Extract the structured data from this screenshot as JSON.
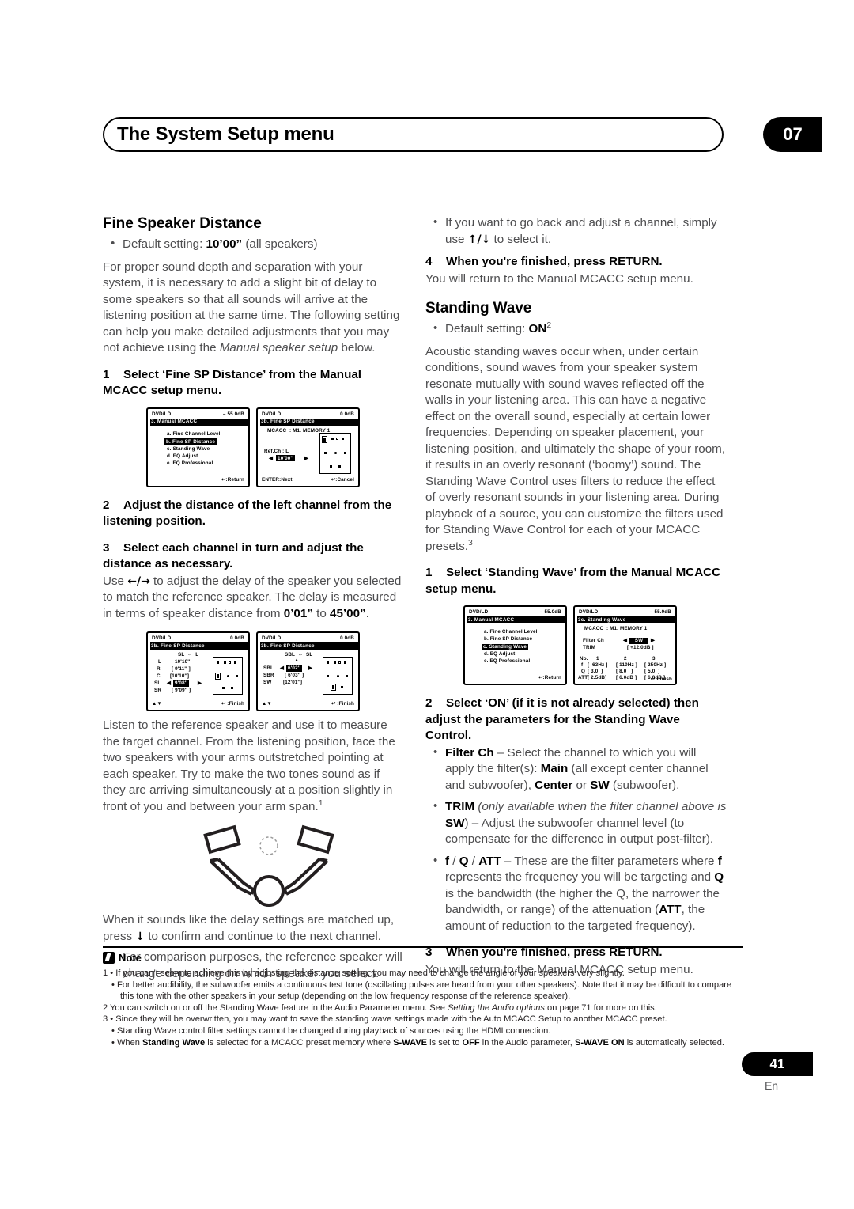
{
  "header": {
    "title": "The System Setup menu",
    "chapter": "07"
  },
  "left_column": {
    "section1_title": "Fine Speaker Distance",
    "default_bullet_pre": "Default setting: ",
    "default_bullet_value": "10’00”",
    "default_bullet_post": " (all speakers)",
    "intro": "For proper sound depth and separation with your system, it is necessary to add a slight bit of delay to some speakers so that all sounds will arrive at the listening position at the same time. The following setting can help you make detailed adjustments that you may not achieve using the ",
    "intro_italic": "Manual speaker setup",
    "intro_end": " below.",
    "step1_num": "1",
    "step1": "Select ‘Fine SP Distance’ from the Manual MCACC setup menu.",
    "step2_num": "2",
    "step2": "Adjust the distance of the left channel from the listening position.",
    "step3_num": "3",
    "step3": "Select each channel in turn and adjust the distance as necessary.",
    "step3_body_a": "Use ",
    "step3_arrows": "←/→",
    "step3_body_b": " to adjust the delay of the speaker you selected to match the reference speaker. The delay is measured in terms of speaker distance from ",
    "step3_from": "0’01”",
    "step3_to_word": " to ",
    "step3_to": "45’00”",
    "step3_body_c": ".",
    "listen_para": "Listen to the reference speaker and use it to measure the target channel. From the listening position, face the two speakers with your arms outstretched pointing at each speaker. Try to make the two tones sound as if they are arriving simultaneously at a position slightly in front of you and between your arm span.",
    "listen_para_fn": "1",
    "confirm_a": "When it sounds like the delay settings are matched up, press ",
    "confirm_arrow": "↓",
    "confirm_b": " to confirm and continue to the next channel.",
    "compare_bullet": "For comparison purposes, the reference speaker will change depending on which speaker you select."
  },
  "right_column": {
    "goback_bullet_a": "If you want to go back and adjust a channel, simply use ",
    "goback_arrows": "↑/↓",
    "goback_bullet_b": " to select it.",
    "step4_num": "4",
    "step4": "When you're finished, press RETURN.",
    "step4_body": "You will return to the Manual MCACC setup menu.",
    "section2_title": "Standing Wave",
    "default_bullet_pre": "Default setting: ",
    "default_bullet_value": "ON",
    "default_bullet_fn": "2",
    "sw_intro": "Acoustic standing waves occur when, under certain conditions, sound waves from your speaker system resonate mutually with sound waves reflected off the walls in your listening area. This can have a negative effect on the overall sound, especially at certain lower frequencies. Depending on speaker placement, your listening position, and ultimately the shape of your room, it results in an overly resonant (‘boomy’) sound. The Standing Wave Control uses filters to reduce the effect of overly resonant sounds in your listening area. During playback of a source, you can customize the filters used for Standing Wave Control for each of your MCACC presets.",
    "sw_intro_fn": "3",
    "step1_num": "1",
    "step1": "Select ‘Standing Wave’ from the Manual MCACC setup menu.",
    "step2_num": "2",
    "step2": "Select ‘ON’ (if it is not already selected) then adjust the parameters for the Standing Wave Control.",
    "bullet_filterch_b1": "Filter Ch",
    "bullet_filterch_t1": " – Select the channel to which you will apply the filter(s): ",
    "bullet_filterch_b2": "Main",
    "bullet_filterch_t2": " (all except center channel and subwoofer), ",
    "bullet_filterch_b3": "Center",
    "bullet_filterch_t3": " or ",
    "bullet_filterch_b4": "SW",
    "bullet_filterch_t4": " (subwoofer).",
    "bullet_trim_b1": "TRIM",
    "bullet_trim_i1": " (only available when the filter channel above is ",
    "bullet_trim_b2": "SW",
    "bullet_trim_t2": ") – Adjust the subwoofer channel level (to compensate for the difference in output post-filter).",
    "bullet_fqatt_b1": "f",
    "bullet_fqatt_s1": " / ",
    "bullet_fqatt_b2": "Q",
    "bullet_fqatt_s2": " / ",
    "bullet_fqatt_b3": "ATT",
    "bullet_fqatt_t1": " – These are the filter parameters where ",
    "bullet_fqatt_b4": "f",
    "bullet_fqatt_t2": " represents the frequency you will be targeting and ",
    "bullet_fqatt_b5": "Q",
    "bullet_fqatt_t3": " is the bandwidth (the higher the Q, the narrower the bandwidth, or range) of the attenuation (",
    "bullet_fqatt_b6": "ATT",
    "bullet_fqatt_t4": ", the amount of reduction to the targeted frequency).",
    "step3_num": "3",
    "step3": "When you're finished, press RETURN.",
    "step3_body": "You will return to the Manual MCACC setup menu."
  },
  "lcd_screens": {
    "menu_mcacc": {
      "source": "DVD/LD",
      "level": "– 55.0dB",
      "title": "3. Manual MCACC",
      "items": [
        "a. Fine Channel Level",
        "b. Fine SP Distance",
        "c. Standing Wave",
        "d. EQ Adjust",
        "e. EQ Professional"
      ],
      "footer_right": "↩:Return"
    },
    "fine_sp_distance_initial": {
      "source": "DVD/LD",
      "level": "0.0dB",
      "title": "3b. Fine SP Distance",
      "memory": "MCACC  : M1. MEMORY 1",
      "refch": "Ref.Ch : L",
      "value": "10'00''",
      "footer_left": "ENTER:Next",
      "footer_right": "↩:Cancel"
    },
    "fine_sp_distance_front": {
      "source": "DVD/LD",
      "level": "0.0dB",
      "title": "3b. Fine SP Distance",
      "pairline": "SL  ⇔  L",
      "rows": [
        {
          "ch": "L",
          "val": "10'10''",
          "bracket": false,
          "sel": false
        },
        {
          "ch": "R",
          "val": "9'11''",
          "bracket": true,
          "sel": false
        },
        {
          "ch": "C",
          "val": "10'10''",
          "bracket": true,
          "sel": false
        },
        {
          "ch": "SL",
          "val": "9'08''",
          "bracket": false,
          "sel": true
        },
        {
          "ch": "SR",
          "val": "9'09''",
          "bracket": true,
          "sel": false
        }
      ],
      "footer_left": "▲▼",
      "footer_right": "↩ :Finish"
    },
    "fine_sp_distance_rear": {
      "source": "DVD/LD",
      "level": "0.0dB",
      "title": "3b. Fine SP Distance",
      "pairline": "SBL  ⇔  SL",
      "rows": [
        {
          "ch": "SBL",
          "val": "6'02''",
          "bracket": false,
          "sel": true
        },
        {
          "ch": "SBR",
          "val": "6'03''",
          "bracket": true,
          "sel": false
        },
        {
          "ch": "SW",
          "val": "12'01''",
          "bracket": true,
          "sel": false
        }
      ],
      "footer_left": "▲▼",
      "footer_right": "↩ :Finish"
    },
    "standing_wave": {
      "source": "DVD/LD",
      "level": "– 55.0dB",
      "title": "3c. Standing Wave",
      "memory": "MCACC  : M1. MEMORY 1",
      "filter_ch_label": "Filter Ch",
      "filter_ch_value": "SW",
      "trim_label": "TRIM",
      "trim_value": "[ +12.0dB ]",
      "table_header": [
        "No.",
        "1",
        "2",
        "3"
      ],
      "row_f": {
        "label": "f",
        "values": [
          "63Hz",
          "110Hz",
          "250Hz"
        ]
      },
      "row_q": {
        "label": "Q",
        "values": [
          "3.0",
          "8.0",
          "5.0"
        ]
      },
      "row_att": {
        "label": "ATT",
        "values": [
          "2.5dB",
          "6.0dB",
          "6.0dB"
        ]
      },
      "footer_right": "↩:Finish"
    }
  },
  "notes": {
    "label": "Note",
    "n1a": "1 • If you can’t seem to achieve this by adjusting the distance setting, you may need to change the angle of your speakers very slightly.",
    "n1b": "• For better audibility, the subwoofer emits a continuous test tone (oscillating pulses are heard from your other speakers). Note that it may be difficult to compare this tone with the other speakers in your setup (depending on the low frequency response of the reference speaker).",
    "n2_a": "2 You can switch on or off the Standing Wave feature in the Audio Parameter menu. See ",
    "n2_i": "Setting the Audio options",
    "n2_b": " on page 71 for more on this.",
    "n3a": "3 • Since they will be overwritten, you may want to save the standing wave settings made with the Auto MCACC Setup to another MCACC preset.",
    "n3b": "• Standing Wave control filter settings cannot be changed during playback of sources using the HDMI connection.",
    "n3c_a": "• When ",
    "n3c_b1": "Standing Wave",
    "n3c_t1": " is selected for a MCACC preset memory where ",
    "n3c_b2": "S-WAVE",
    "n3c_t2": " is set to ",
    "n3c_b3": "OFF",
    "n3c_t3": " in the Audio parameter, ",
    "n3c_b4": "S-WAVE ON",
    "n3c_t4": " is automatically selected."
  },
  "footer": {
    "page_number": "41",
    "language": "En"
  }
}
